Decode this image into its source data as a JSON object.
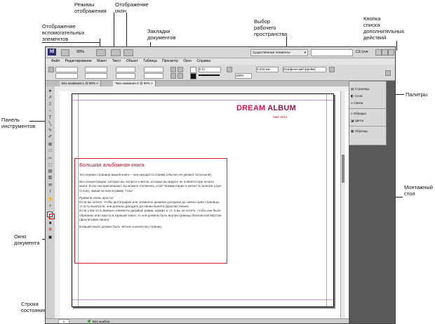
{
  "callouts": {
    "helpers": "Отображение\nвспомогательных\nэлементов",
    "modes": "Режимы\nотображения",
    "windows": "Отображение\nокон",
    "tabs": "Закладки\nдокументов",
    "workspace": "Выбор\nрабочего\nпространства",
    "extra_button": "Кнопка\nсписка\nдополнительных\nдействий",
    "palettes": "Палитры",
    "toolbox": "Панель\nинструментов",
    "pasteboard": "Монтажный\nстол",
    "doc_window": "Окно\nдокумента",
    "status": "Строка\nсостояния"
  },
  "appbar": {
    "logo": "Id",
    "zoom": "99%",
    "workspace_label": "Существенные элементы",
    "search_placeholder": "",
    "cs_live": "CS Live"
  },
  "menu": [
    "Файл",
    "Редактирование",
    "Макет",
    "Текст",
    "Объект",
    "Таблица",
    "Просмотр",
    "Окно",
    "Справка"
  ],
  "control": {
    "stroke_size": "0 пт",
    "percent": "100%",
    "x_value": "4,233 мм",
    "style": "[Графический фрейм]"
  },
  "tabs": [
    {
      "label": "Без названия-1 @ 90%"
    },
    {
      "label": "*Без названия-2 @ 90%"
    }
  ],
  "document": {
    "logo_part1": "DREAM",
    "logo_part2": "ALBUM",
    "logo_date": "Май 2010",
    "heading": "Большая альбомная книга",
    "paragraphs": [
      "Это первая страница вашей книги – она находится справа (обычно не делают титульной).",
      "Вся концентрация, которые вы читаете и меток, которые вы видите не появятся при печати книги. Если они вам мешают, вы можете отключить слой \"Комментарии и метки\" в палитре Layer (Слои), нажав на пиктограмму \"глаз\".",
      "Правила очень просты:\nЕсли вы хотите, чтобы фотография или элементы дизайна доходили до самого края страницы, то есть вылетали, они должны доходить до линии вылета (красная линия)\nЕсли у вас есть важные элементы дизайна: рамки, шрифт и т.п. и вы не хотите, чтобы они были обрезаны или скрыты в корешке книги, то они должны быть внутри границы безопасной вёрстки (фиолетовая линия)",
      "В вашей книге должно быть чётное количество страниц"
    ]
  },
  "panels": [
    {
      "label": "Страницы",
      "icon": "pages-icon"
    },
    {
      "label": "Слои",
      "icon": "layers-icon"
    },
    {
      "label": "Связи",
      "icon": "links-icon"
    },
    {
      "label": "Обводка",
      "icon": "stroke-icon"
    },
    {
      "label": "Цвета",
      "icon": "swatches-icon"
    },
    {
      "label": "Образцы",
      "icon": "samples-icon"
    }
  ],
  "status": {
    "page": "1",
    "state": "Без ошибок"
  },
  "colors": {
    "logo_red": "#d4145a",
    "heading_red": "#c8102e",
    "bleed_red": "#e4232c",
    "margin_purple": "#a24bc7"
  }
}
